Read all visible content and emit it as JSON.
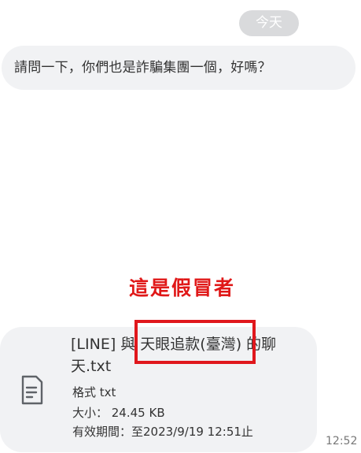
{
  "chat": {
    "date_separator": "今天",
    "incoming_message": "請問一下，你們也是詐騙集團一個，好嗎？",
    "file": {
      "icon": "document-icon",
      "name": "[LINE] 與 天眼追款(臺灣) 的聊天.txt",
      "format_line": "格式 txt",
      "size_line": "大小： 24.45 KB",
      "expiry_line": "有效期間：至2023/9/19 12:51止",
      "time": "12:52"
    }
  },
  "annotation": {
    "text": "這是假冒者",
    "color": "#e01818"
  }
}
